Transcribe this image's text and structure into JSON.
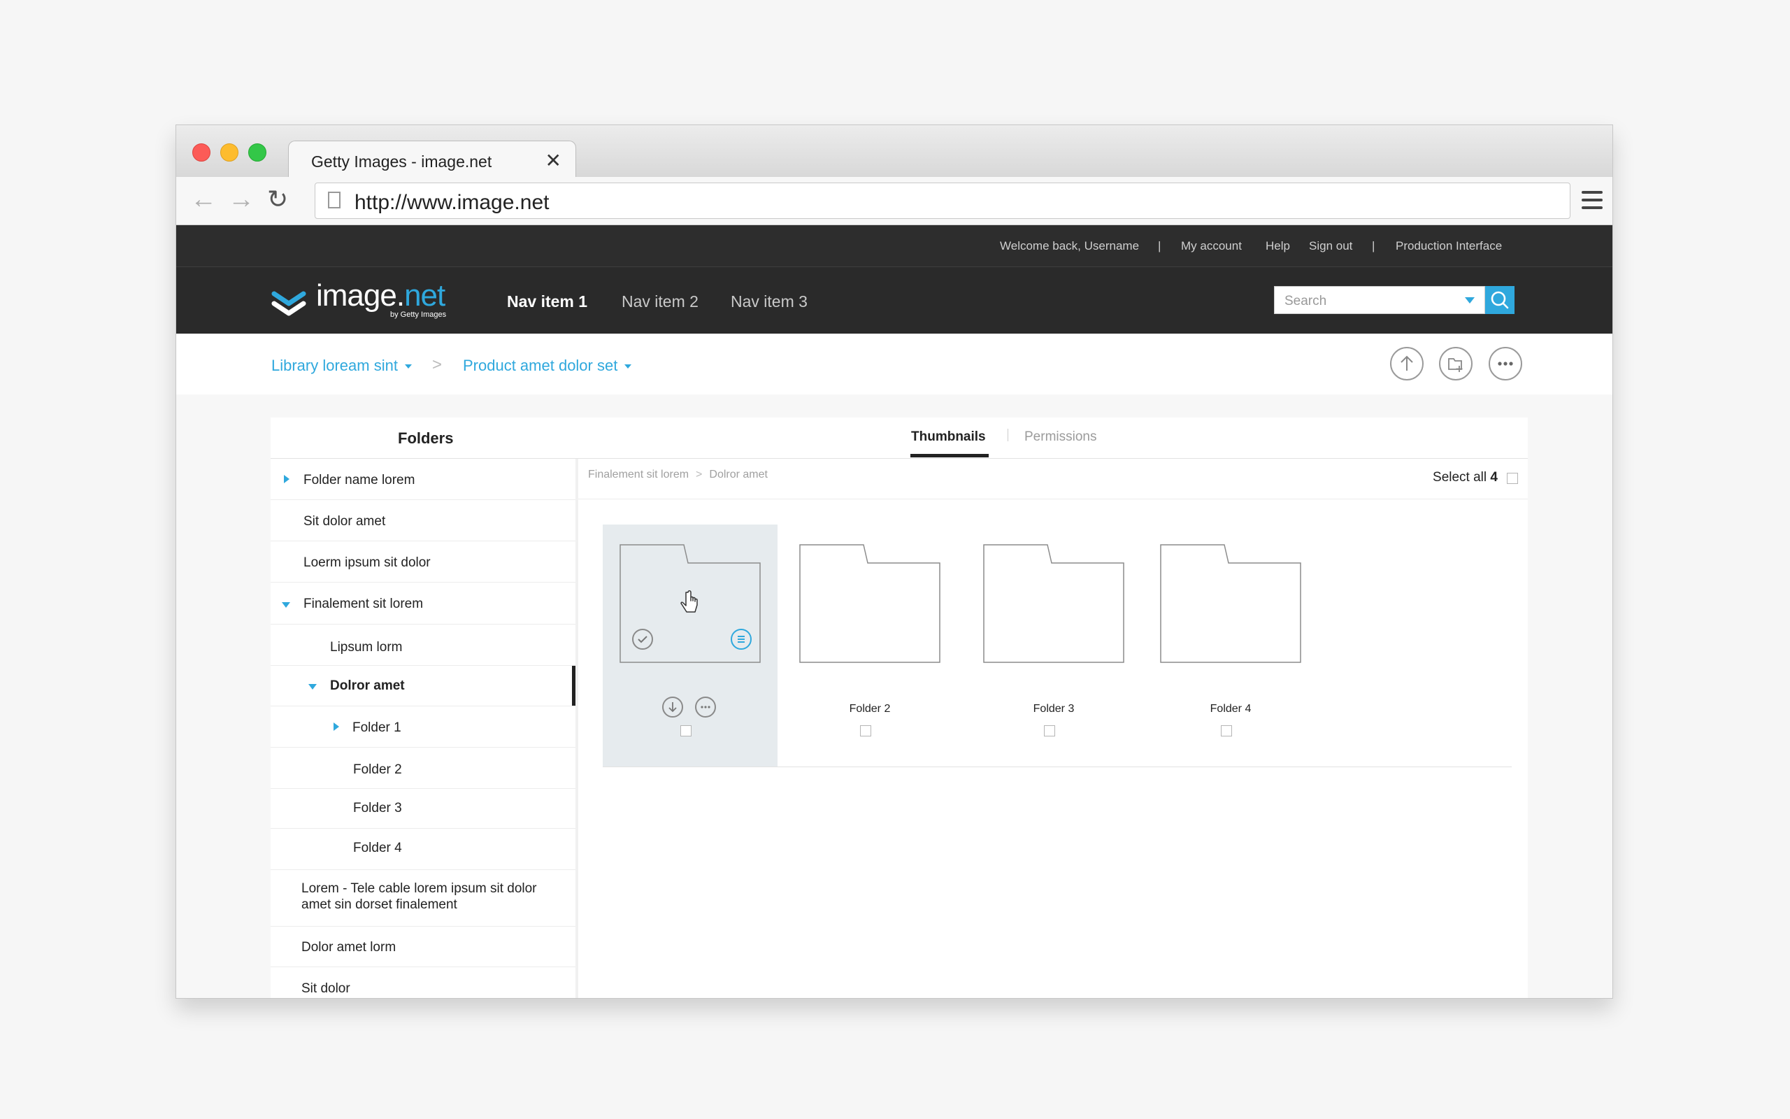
{
  "browser": {
    "tab_title": "Getty Images - image.net",
    "tab_close": "✕",
    "url": "http://www.image.net"
  },
  "util_bar": {
    "welcome": "Welcome back, Username",
    "sep1": "|",
    "my_account": "My account",
    "help": "Help",
    "sign_out": "Sign out",
    "sep2": "|",
    "production": "Production Interface"
  },
  "logo": {
    "text_main": "image",
    "text_dot": ".",
    "text_net": "net",
    "sub": "by Getty Images"
  },
  "nav": {
    "items": [
      "Nav item 1",
      "Nav item 2",
      "Nav item 3"
    ],
    "active": "Nav item 1"
  },
  "search": {
    "placeholder": "Search"
  },
  "breadcrumb": {
    "library": "Library loream sint",
    "separator": ">",
    "product": "Product amet dolor set"
  },
  "panel": {
    "folders_title": "Folders",
    "tabs": {
      "thumbnails": "Thumbnails",
      "permissions": "Permissions",
      "active": "Thumbnails"
    }
  },
  "sidebar": {
    "items": [
      {
        "label": "Folder name lorem",
        "arrow": "right"
      },
      {
        "label": "Sit dolor amet"
      },
      {
        "label": "Loerm ipsum sit dolor"
      },
      {
        "label": "Finalement sit lorem",
        "arrow": "down"
      },
      {
        "label": "Lipsum lorm"
      },
      {
        "label": "Dolror amet",
        "arrow": "down",
        "selected": true
      },
      {
        "label": "Folder 1",
        "arrow": "right"
      },
      {
        "label": "Folder 2"
      },
      {
        "label": "Folder 3"
      },
      {
        "label": "Folder 4"
      },
      {
        "label": "Lorem - Tele cable lorem ipsum sit dolor amet sin dorset finalement"
      },
      {
        "label": "Dolor amet lorm"
      },
      {
        "label": "Sit dolor"
      }
    ]
  },
  "content": {
    "trail": [
      "Finalement sit lorem",
      "Dolror amet"
    ],
    "trail_sep": ">",
    "select_all_label": "Select all",
    "select_all_count": "4",
    "folders": [
      {
        "label": "",
        "hovered": true
      },
      {
        "label": "Folder 2"
      },
      {
        "label": "Folder 3"
      },
      {
        "label": "Folder 4"
      }
    ]
  },
  "colors": {
    "accent": "#2fa8dd",
    "nav_bg": "#2a2a2a",
    "hover_card": "#e6ebee"
  },
  "icons": [
    "back-arrow-icon",
    "forward-arrow-icon",
    "reload-icon",
    "page-icon",
    "hamburger-menu-icon",
    "search-icon",
    "upload-icon",
    "add-folder-icon",
    "more-icon",
    "check-icon",
    "details-icon",
    "download-icon",
    "cursor-hand-icon"
  ]
}
